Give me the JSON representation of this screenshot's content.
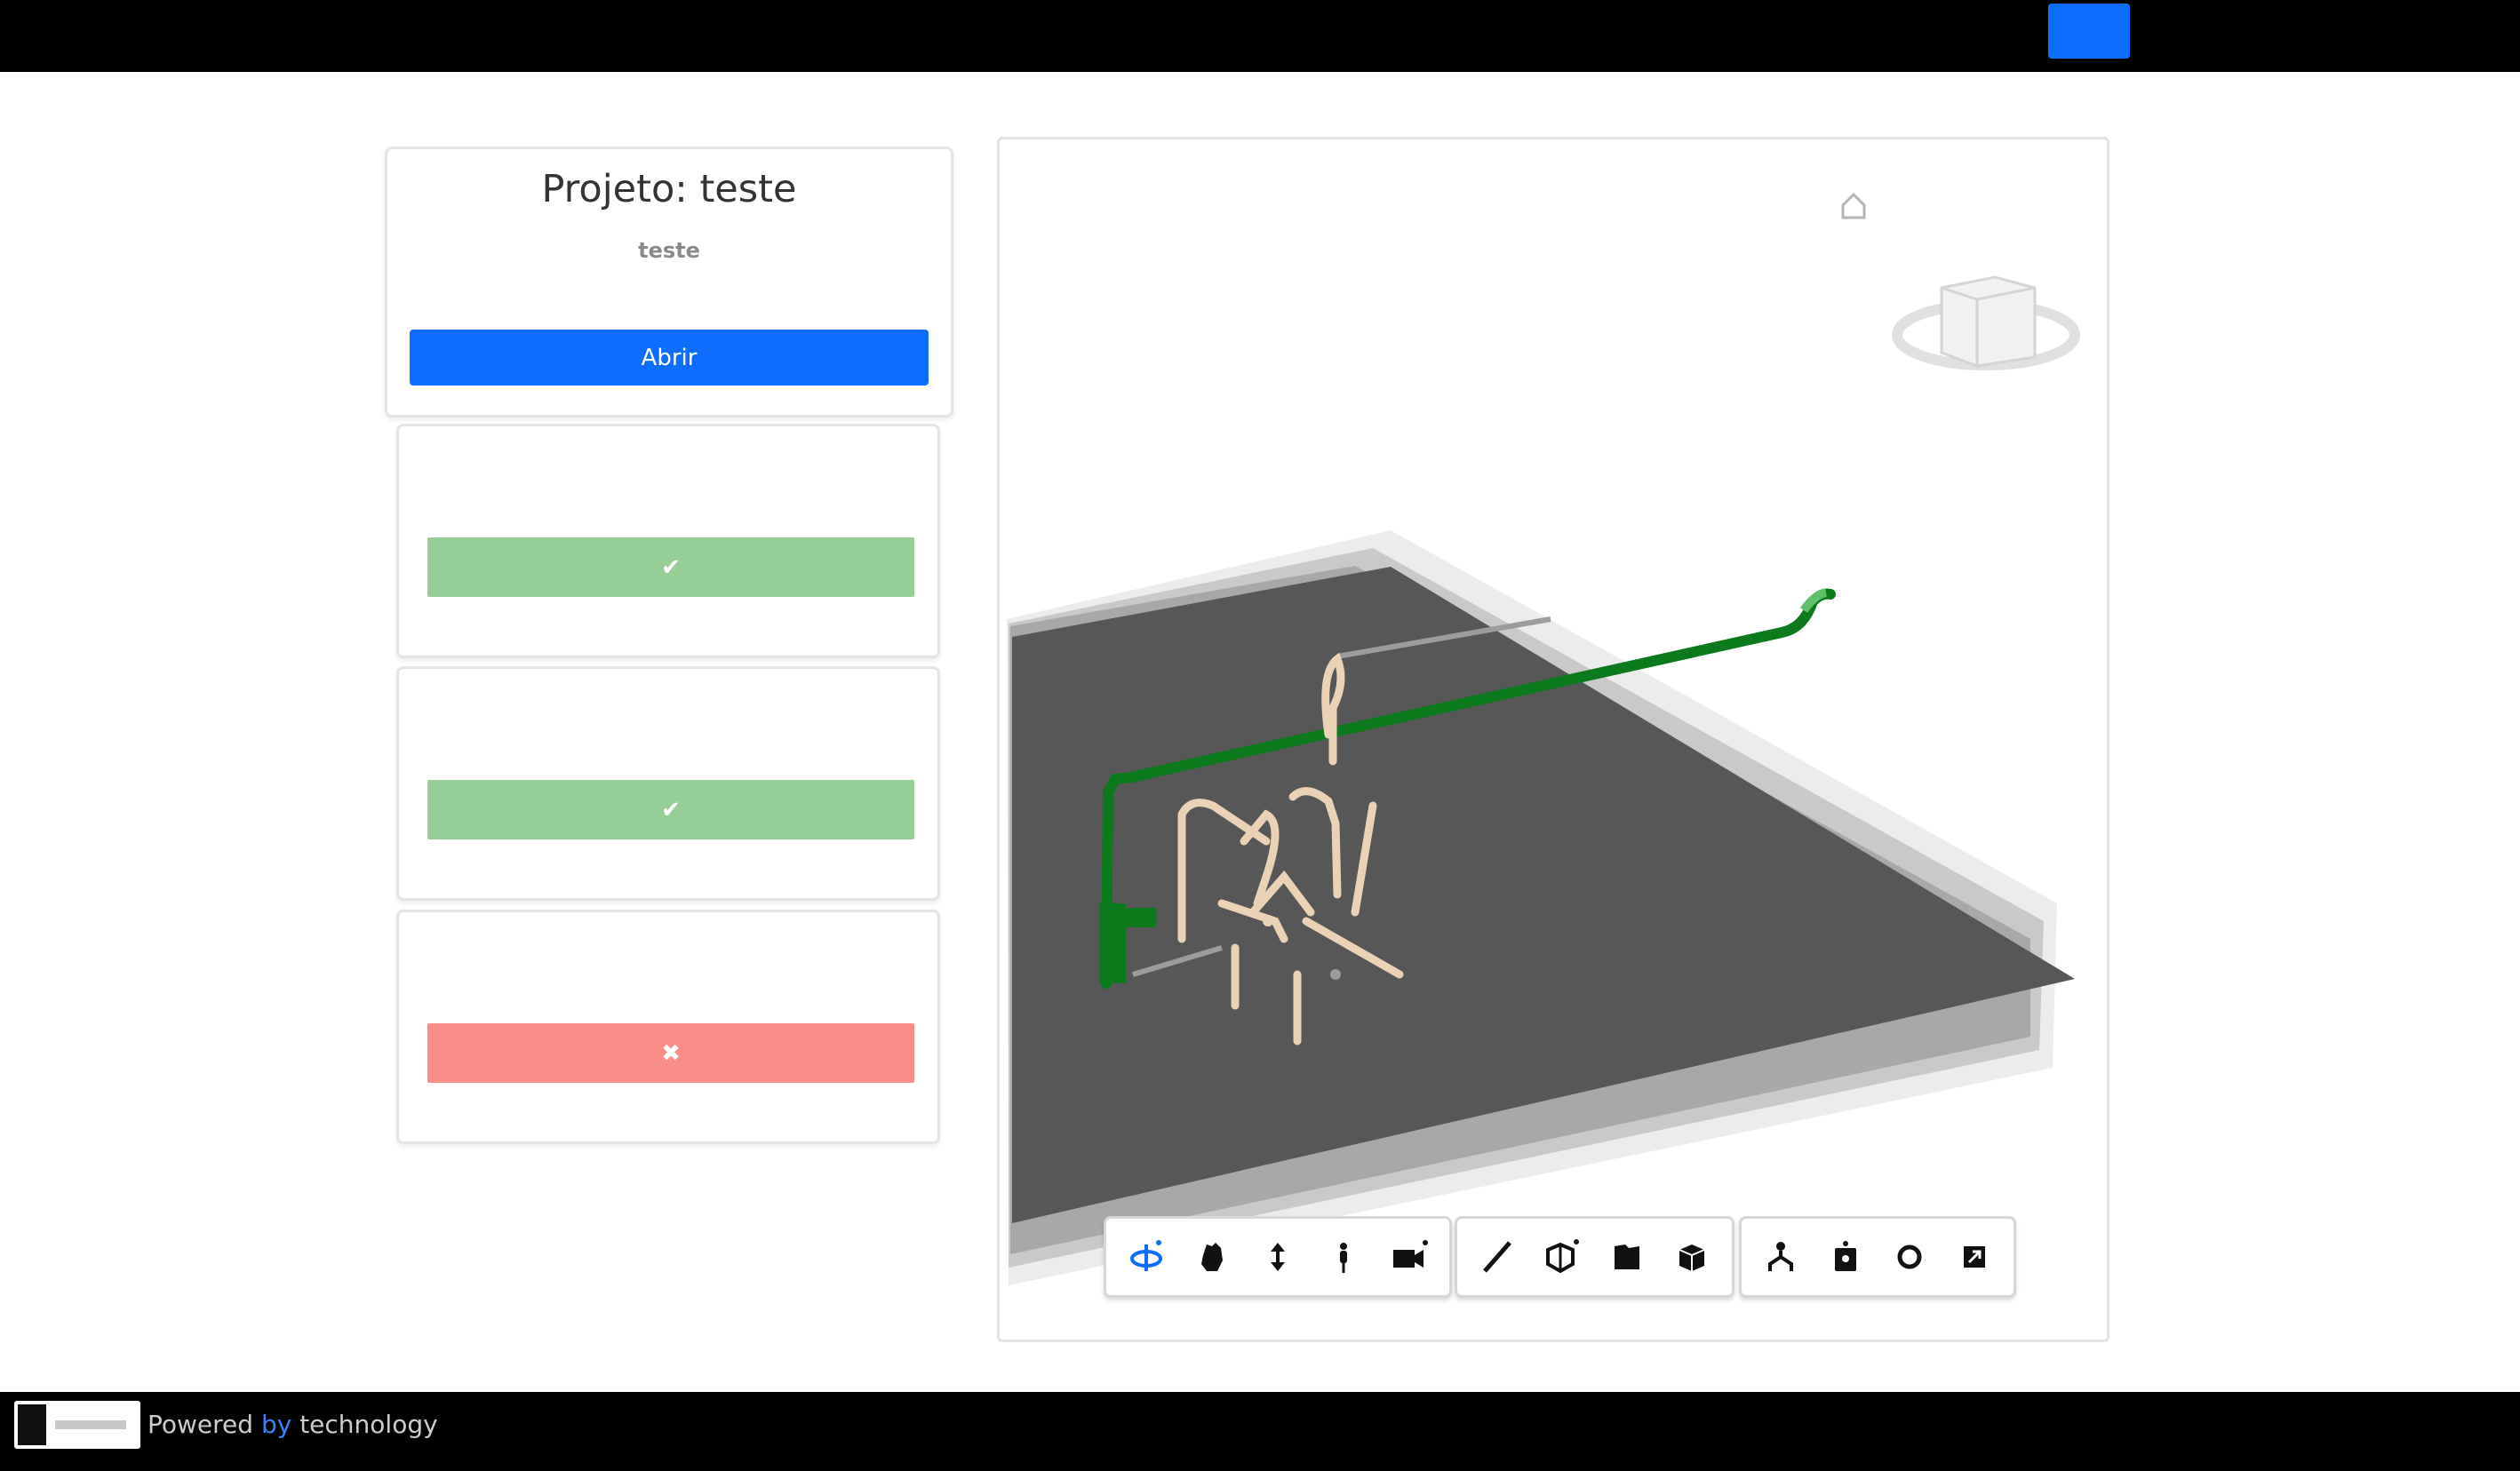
{
  "header": {
    "action_button_label": ""
  },
  "project": {
    "title": "Projeto: teste",
    "description": "teste",
    "date": "",
    "open_button_label": "Abrir"
  },
  "checks": [
    {
      "label": "",
      "status": "ok",
      "icon": "check-icon",
      "color": "#96cf96"
    },
    {
      "label": "",
      "status": "ok",
      "icon": "check-icon",
      "color": "#96cf96"
    },
    {
      "label": "",
      "status": "fail",
      "icon": "x-icon",
      "color": "#f88e86"
    }
  ],
  "viewer": {
    "home_icon": "home-icon",
    "nav_cube_icon": "view-cube-icon",
    "toolbar_groups": [
      [
        "orbit-icon",
        "pan-icon",
        "zoom-icon",
        "first-person-icon",
        "camera-icon"
      ],
      [
        "measure-icon",
        "section-icon",
        "explode-icon",
        "model-browser-icon"
      ],
      [
        "structure-icon",
        "properties-icon",
        "settings-icon",
        "fullscreen-icon"
      ]
    ],
    "active_tool": "orbit-icon",
    "colors": {
      "ground": "#575757",
      "pipe_green": "#0a7a1a",
      "pipe_beige": "#ecd2b5",
      "accent": "#0d6efd"
    }
  },
  "footer": {
    "powered_prefix": "Powered ",
    "powered_by": "by",
    "powered_brand": " technology"
  }
}
